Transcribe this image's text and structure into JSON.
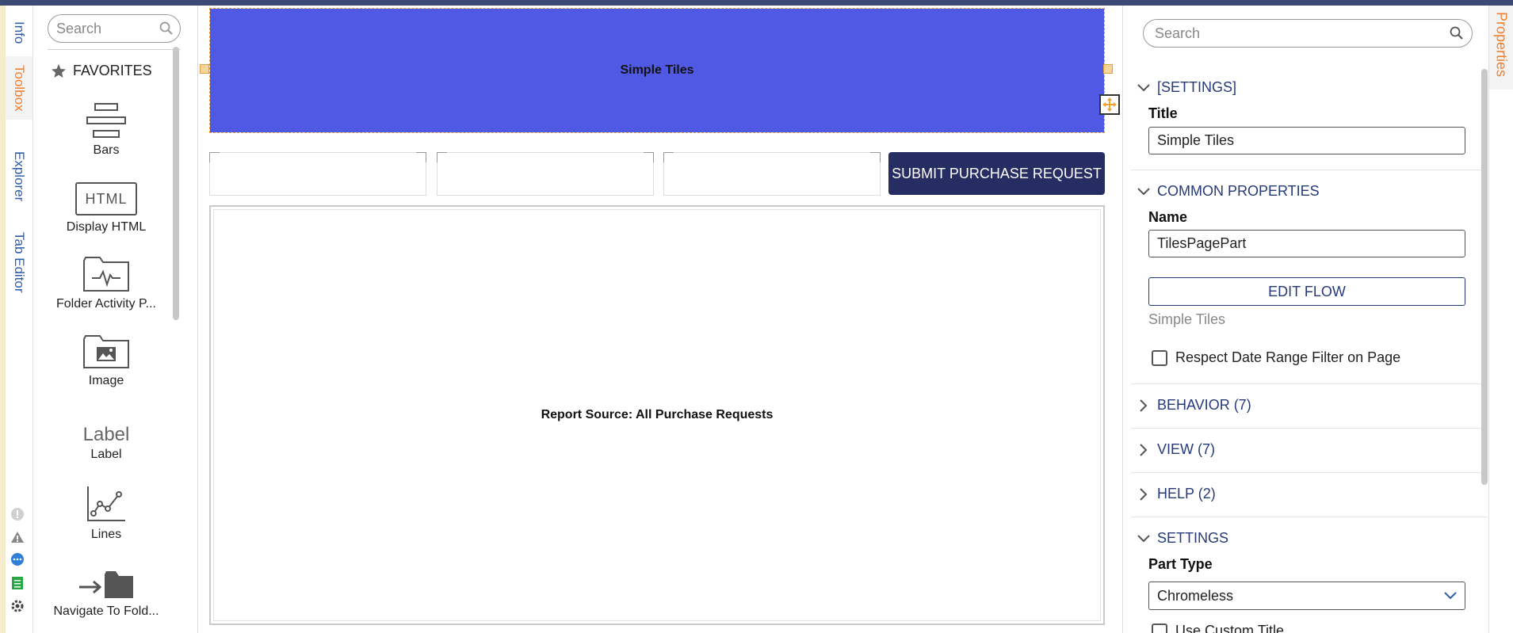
{
  "left_tabs": [
    "Info",
    "Toolbox",
    "Explorer",
    "Tab Editor"
  ],
  "toolbox": {
    "search_placeholder": "Search",
    "favorites_label": "FAVORITES",
    "tools": [
      "Bars",
      "Display HTML",
      "Folder Activity P...",
      "Image",
      "Label",
      "Lines",
      "Navigate To Fold..."
    ],
    "html_icon_text": "HTML",
    "label_icon_text": "Label"
  },
  "canvas": {
    "tiles_title": "Simple Tiles",
    "submit_button": "SUBMIT PURCHASE REQUEST",
    "report_text": "Report Source: All Purchase Requests"
  },
  "properties": {
    "tab_label": "Properties",
    "search_placeholder": "Search",
    "settings_header": "[SETTINGS]",
    "title_label": "Title",
    "title_value": "Simple Tiles",
    "common_header": "COMMON PROPERTIES",
    "name_label": "Name",
    "name_value": "TilesPagePart",
    "edit_flow_button": "EDIT FLOW",
    "flow_name": "Simple Tiles",
    "respect_date_label": "Respect Date Range Filter on Page",
    "behavior_header": "BEHAVIOR (7)",
    "view_header": "VIEW (7)",
    "help_header": "HELP (2)",
    "settings2_header": "SETTINGS",
    "part_type_label": "Part Type",
    "part_type_value": "Chromeless",
    "use_custom_title_label": "Use Custom Title"
  },
  "colors": {
    "accent_orange": "#f07f2e",
    "nav_blue": "#263a79",
    "tiles_fill": "#5059e4",
    "submit_bg": "#262d63"
  }
}
